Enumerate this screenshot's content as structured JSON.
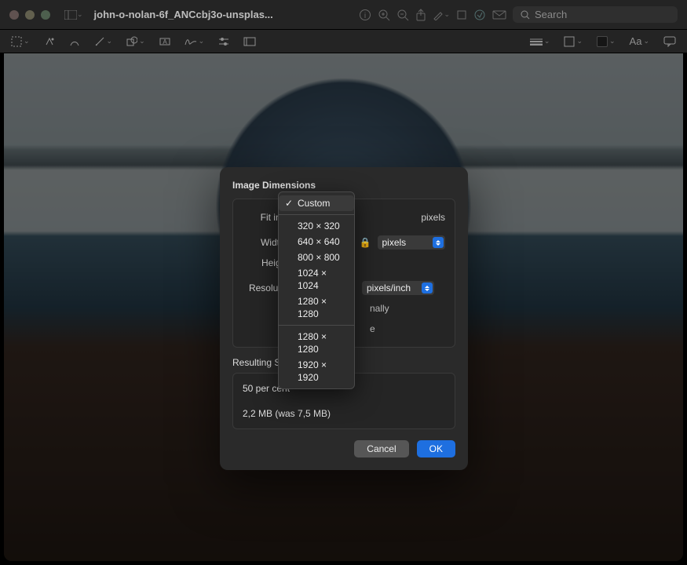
{
  "window": {
    "title": "john-o-nolan-6f_ANCcbj3o-unsplas...",
    "search_placeholder": "Search"
  },
  "dialog": {
    "title": "Image Dimensions",
    "fit_label": "Fit into:",
    "fit_unit": "pixels",
    "width_label": "Width:",
    "height_label": "Height:",
    "resolution_label": "Resolution:",
    "width_unit": "pixels",
    "res_unit": "pixels/inch",
    "scale_proportional": "nally",
    "resample_tail": "e",
    "result_title": "Resulting Si",
    "percent_line": "50 per cent",
    "size_line": "2,2 MB (was 7,5 MB)",
    "cancel": "Cancel",
    "ok": "OK"
  },
  "fit_menu": {
    "selected": "Custom",
    "group1": [
      "320 × 320",
      "640 × 640",
      "800 × 800",
      "1024 × 1024",
      "1280 × 1280"
    ],
    "group2": [
      "1280 × 1280",
      "1920 × 1920"
    ]
  }
}
